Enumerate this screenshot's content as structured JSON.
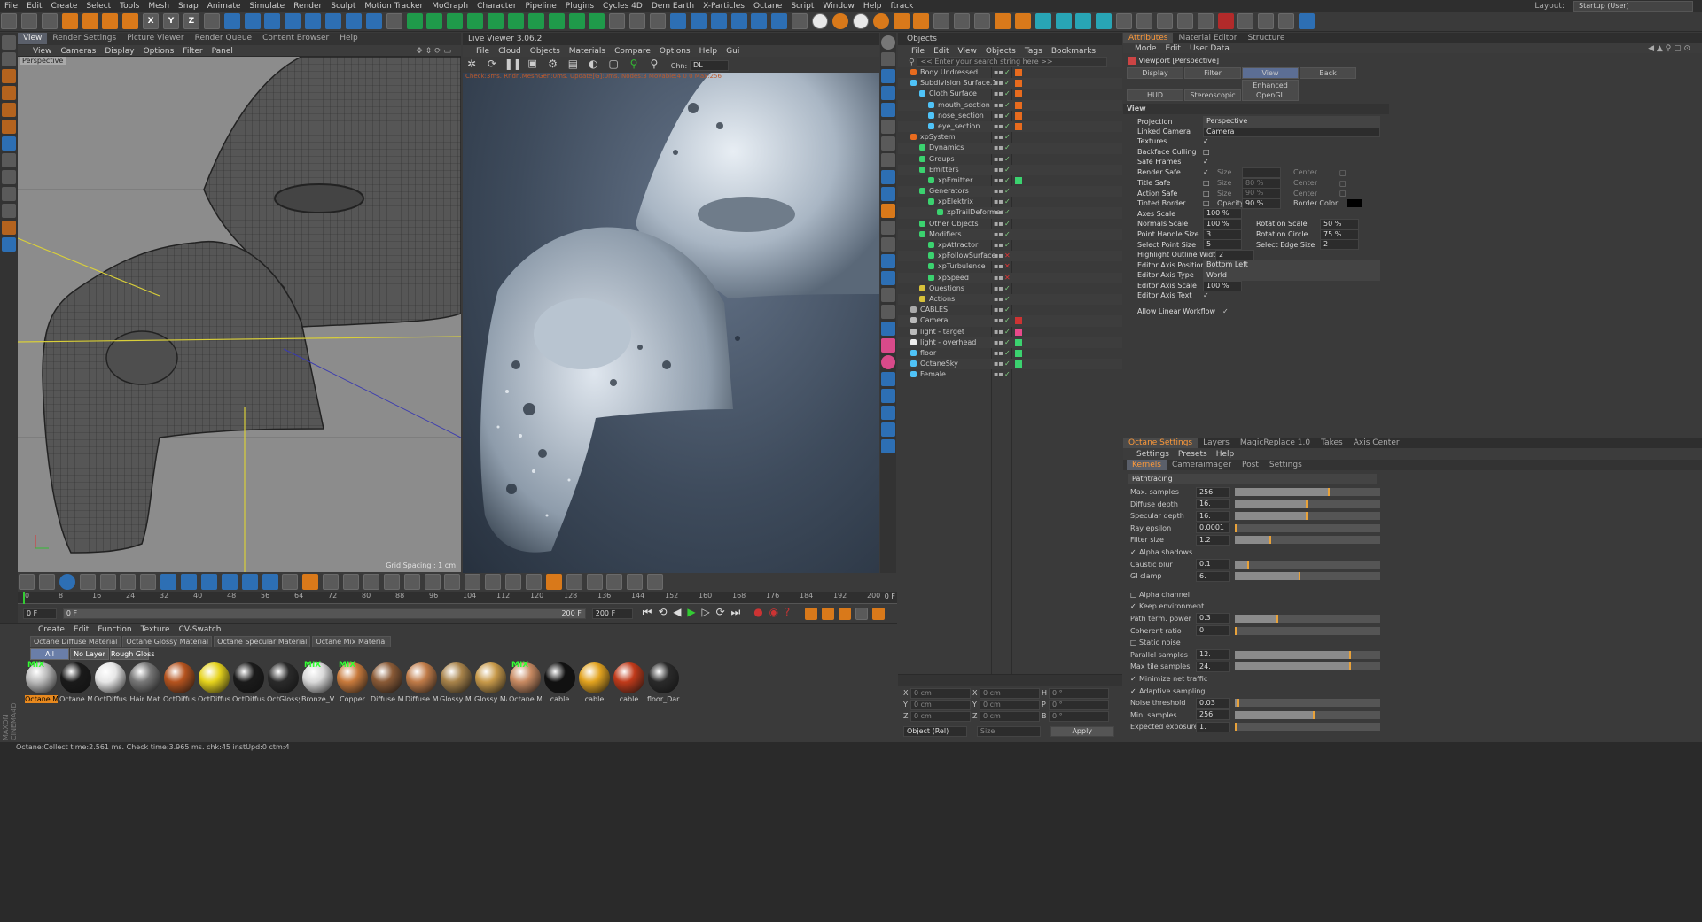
{
  "app": {
    "menu": [
      "File",
      "Edit",
      "Create",
      "Select",
      "Tools",
      "Mesh",
      "Snap",
      "Animate",
      "Simulate",
      "Render",
      "Sculpt",
      "Motion Tracker",
      "MoGraph",
      "Character",
      "Pipeline",
      "Plugins",
      "Cycles 4D",
      "Dem Earth",
      "X-Particles",
      "Octane",
      "Script",
      "Window",
      "Help",
      "ftrack"
    ],
    "layout_label": "Layout:",
    "layout_value": "Startup (User)",
    "toolbar_xyz": [
      "X",
      "Y",
      "Z"
    ]
  },
  "viewport": {
    "tabs": [
      "View",
      "Render Settings",
      "Picture Viewer",
      "Render Queue",
      "Content Browser",
      "Help"
    ],
    "menu": [
      "View",
      "Cameras",
      "Display",
      "Options",
      "Filter",
      "Panel"
    ],
    "label": "Perspective",
    "grid_spacing": "Grid Spacing : 1 cm"
  },
  "live_viewer": {
    "title": "Live Viewer 3.06.2",
    "menu": [
      "File",
      "Cloud",
      "Objects",
      "Materials",
      "Compare",
      "Options",
      "Help",
      "Gui"
    ],
    "chn_label": "Chn:",
    "chn_value": "DL",
    "status": "Check:3ms. Rndr..MeshGen:0ms. Update[G]:0ms. Nodes:3 Movable:4 0 0 Max:256"
  },
  "objects": {
    "title": "Objects",
    "menu": [
      "File",
      "Edit",
      "View",
      "Objects",
      "Tags",
      "Bookmarks"
    ],
    "search_placeholder": "<< Enter your search string here >>",
    "rows": [
      {
        "name": "Body Undressed",
        "indent": 0
      },
      {
        "name": "Subdivision Surface.1",
        "indent": 0
      },
      {
        "name": "Cloth Surface",
        "indent": 1
      },
      {
        "name": "mouth_section",
        "indent": 2
      },
      {
        "name": "nose_section",
        "indent": 2
      },
      {
        "name": "eye_section",
        "indent": 2
      },
      {
        "name": "xpSystem",
        "indent": 0
      },
      {
        "name": "Dynamics",
        "indent": 1
      },
      {
        "name": "Groups",
        "indent": 1
      },
      {
        "name": "Emitters",
        "indent": 1
      },
      {
        "name": "xpEmitter",
        "indent": 2
      },
      {
        "name": "Generators",
        "indent": 1
      },
      {
        "name": "xpElektrix",
        "indent": 2
      },
      {
        "name": "xpTrailDeformer",
        "indent": 3
      },
      {
        "name": "Other Objects",
        "indent": 1
      },
      {
        "name": "Modifiers",
        "indent": 1
      },
      {
        "name": "xpAttractor",
        "indent": 2
      },
      {
        "name": "xpFollowSurface",
        "indent": 2
      },
      {
        "name": "xpTurbulence",
        "indent": 2
      },
      {
        "name": "xpSpeed",
        "indent": 2
      },
      {
        "name": "Questions",
        "indent": 1
      },
      {
        "name": "Actions",
        "indent": 1
      },
      {
        "name": "CABLES",
        "indent": 0
      },
      {
        "name": "Camera",
        "indent": 0
      },
      {
        "name": "light - target",
        "indent": 0
      },
      {
        "name": "light - overhead",
        "indent": 0
      },
      {
        "name": "floor",
        "indent": 0
      },
      {
        "name": "OctaneSky",
        "indent": 0
      },
      {
        "name": "Female",
        "indent": 0
      }
    ]
  },
  "coords": {
    "rows": [
      {
        "a": "X",
        "av": "0 cm",
        "b": "X",
        "bv": "0 cm",
        "c": "H",
        "cv": "0 °"
      },
      {
        "a": "Y",
        "av": "0 cm",
        "b": "Y",
        "bv": "0 cm",
        "c": "P",
        "cv": "0 °"
      },
      {
        "a": "Z",
        "av": "0 cm",
        "b": "Z",
        "bv": "0 cm",
        "c": "B",
        "cv": "0 °"
      }
    ],
    "mode": "Object (Rel)",
    "size": "Size",
    "apply": "Apply"
  },
  "attributes": {
    "tabs": [
      "Attributes",
      "Material Editor",
      "Structure"
    ],
    "menu": [
      "Mode",
      "Edit",
      "User Data"
    ],
    "title": "Viewport [Perspective]",
    "subtabs": [
      "Display",
      "Filter",
      "View",
      "Back",
      "HUD",
      "Stereoscopic",
      "Enhanced OpenGL"
    ],
    "section": "View",
    "projection_label": "Projection",
    "projection_value": "Perspective",
    "linked_camera_label": "Linked Camera",
    "linked_camera_value": "Camera",
    "checks": [
      {
        "label": "Textures",
        "on": true
      },
      {
        "label": "Backface Culling",
        "on": false
      },
      {
        "label": "Safe Frames",
        "on": true
      }
    ],
    "safe_rows": [
      {
        "label": "Render Safe",
        "on": true,
        "size": "",
        "center": "Center"
      },
      {
        "label": "Title Safe",
        "on": false,
        "size": "80 %",
        "center": "Center"
      },
      {
        "label": "Action Safe",
        "on": false,
        "size": "90 %",
        "center": "Center"
      }
    ],
    "size_label": "Size",
    "tinted_border": "Tinted Border",
    "opacity_label": "Opacity",
    "opacity_value": "90 %",
    "border_color": "Border Color",
    "axes_scale_label": "Axes Scale",
    "axes_scale_value": "100 %",
    "pairs": [
      {
        "l1": "Normals Scale",
        "v1": "100 %",
        "l2": "Rotation Scale",
        "v2": "50 %"
      },
      {
        "l1": "Point Handle Size",
        "v1": "3",
        "l2": "Rotation Circle",
        "v2": "75 %"
      },
      {
        "l1": "Select Point Size",
        "v1": "5",
        "l2": "Select Edge Size",
        "v2": "2"
      }
    ],
    "highlight_label": "Highlight Outline Width",
    "highlight_value": "2",
    "axis_pos_label": "Editor Axis Position",
    "axis_pos_value": "Bottom Left",
    "axis_type_label": "Editor Axis Type",
    "axis_type_value": "World",
    "axis_scale_label": "Editor Axis Scale",
    "axis_scale_value": "100 %",
    "axis_text_label": "Editor Axis Text",
    "linear_label": "Allow Linear Workflow"
  },
  "octane": {
    "tabs": [
      "Octane Settings",
      "Layers",
      "MagicReplace 1.0",
      "Takes",
      "Axis Center"
    ],
    "menu": [
      "Settings",
      "Presets",
      "Help"
    ],
    "subtabs": [
      "Kernels",
      "Cameraimager",
      "Post",
      "Settings"
    ],
    "kernel": "Pathtracing",
    "params": [
      {
        "label": "Max. samples",
        "value": "256.",
        "fill": 0.65
      },
      {
        "label": "Diffuse depth",
        "value": "16.",
        "fill": 0.5
      },
      {
        "label": "Specular depth",
        "value": "16.",
        "fill": 0.5
      },
      {
        "label": "Ray epsilon",
        "value": "0.0001",
        "fill": 0.01
      },
      {
        "label": "Filter size",
        "value": "1.2",
        "fill": 0.25
      },
      {
        "check": "Alpha shadows",
        "on": true
      },
      {
        "label": "Caustic blur",
        "value": "0.1",
        "fill": 0.1
      },
      {
        "label": "GI clamp",
        "value": "6.",
        "fill": 0.45
      },
      {
        "gap": true
      },
      {
        "check": "Alpha channel",
        "on": false
      },
      {
        "check": "Keep environment",
        "on": true
      },
      {
        "label": "Path term. power",
        "value": "0.3",
        "fill": 0.3
      },
      {
        "label": "Coherent ratio",
        "value": "0",
        "fill": 0.0
      },
      {
        "check": "Static noise",
        "on": false
      },
      {
        "label": "Parallel samples",
        "value": "12.",
        "fill": 0.8
      },
      {
        "label": "Max tile samples",
        "value": "24.",
        "fill": 0.8
      },
      {
        "check": "Minimize net traffic",
        "on": true
      },
      {
        "check": "Adaptive sampling",
        "on": true
      },
      {
        "label": "Noise threshold",
        "value": "0.03",
        "fill": 0.03
      },
      {
        "label": "Min. samples",
        "value": "256.",
        "fill": 0.55
      },
      {
        "label": "Expected exposure",
        "value": "1.",
        "fill": 0.01
      }
    ]
  },
  "timeline": {
    "ticks": [
      "0",
      "8",
      "16",
      "24",
      "32",
      "40",
      "48",
      "56",
      "64",
      "72",
      "80",
      "88",
      "96",
      "104",
      "112",
      "120",
      "128",
      "136",
      "144",
      "152",
      "160",
      "168",
      "176",
      "184",
      "192",
      "200"
    ],
    "frame_end_label": "0 F",
    "start": "0 F",
    "range_start": "0 F",
    "range_end": "200 F",
    "end": "200 F"
  },
  "materials": {
    "menu": [
      "Create",
      "Edit",
      "Function",
      "Texture",
      "CV-Swatch"
    ],
    "tabs": [
      "Octane Diffuse Material",
      "Octane Glossy Material",
      "Octane Specular Material",
      "Octane Mix Material"
    ],
    "filters": [
      "All",
      "No Layer",
      "Rough Gloss"
    ],
    "items": [
      {
        "name": "Octane Mix",
        "color": "#bcbcbc",
        "badge": "MIX"
      },
      {
        "name": "Octane Ma",
        "color": "#1a1a1a",
        "badge": ""
      },
      {
        "name": "OctDiffuse",
        "color": "#e6e6e6",
        "badge": ""
      },
      {
        "name": "Hair Mat",
        "color": "#777777",
        "badge": ""
      },
      {
        "name": "OctDiffuse",
        "color": "#b5531e",
        "badge": ""
      },
      {
        "name": "OctDiffuse",
        "color": "#e6d31c",
        "badge": ""
      },
      {
        "name": "OctDiffuse",
        "color": "#1b1b1b",
        "badge": ""
      },
      {
        "name": "OctGlossy",
        "color": "#2a2a2a",
        "badge": ""
      },
      {
        "name": "Bronze_V1",
        "color": "#d9d9d9",
        "badge": "MIX"
      },
      {
        "name": "Copper",
        "color": "#c87a3c",
        "badge": "MIX"
      },
      {
        "name": "Diffuse Ma",
        "color": "#8a5a36",
        "badge": ""
      },
      {
        "name": "Diffuse Ma",
        "color": "#c07b48",
        "badge": ""
      },
      {
        "name": "Glossy Mat",
        "color": "#a8834a",
        "badge": ""
      },
      {
        "name": "Glossy Mat",
        "color": "#c89a4a",
        "badge": ""
      },
      {
        "name": "Octane Ma",
        "color": "#c88a62",
        "badge": "MIX"
      },
      {
        "name": "cable",
        "color": "#111111",
        "badge": ""
      },
      {
        "name": "cable",
        "color": "#e2a31f",
        "badge": ""
      },
      {
        "name": "cable",
        "color": "#c03a1a",
        "badge": ""
      },
      {
        "name": "floor_Dark",
        "color": "#2a2a2a",
        "badge": ""
      }
    ]
  },
  "status": {
    "text": "Octane:Collect time:2.561 ms.  Check time:3.965 ms.  chk:45  instUpd:0  ctm:4"
  },
  "brand": "MAXON CINEMA4D",
  "colors": {
    "accent": "#ff8a1e",
    "selection": "#5a5f6a",
    "viewport_bg": "#8e8e8e"
  }
}
